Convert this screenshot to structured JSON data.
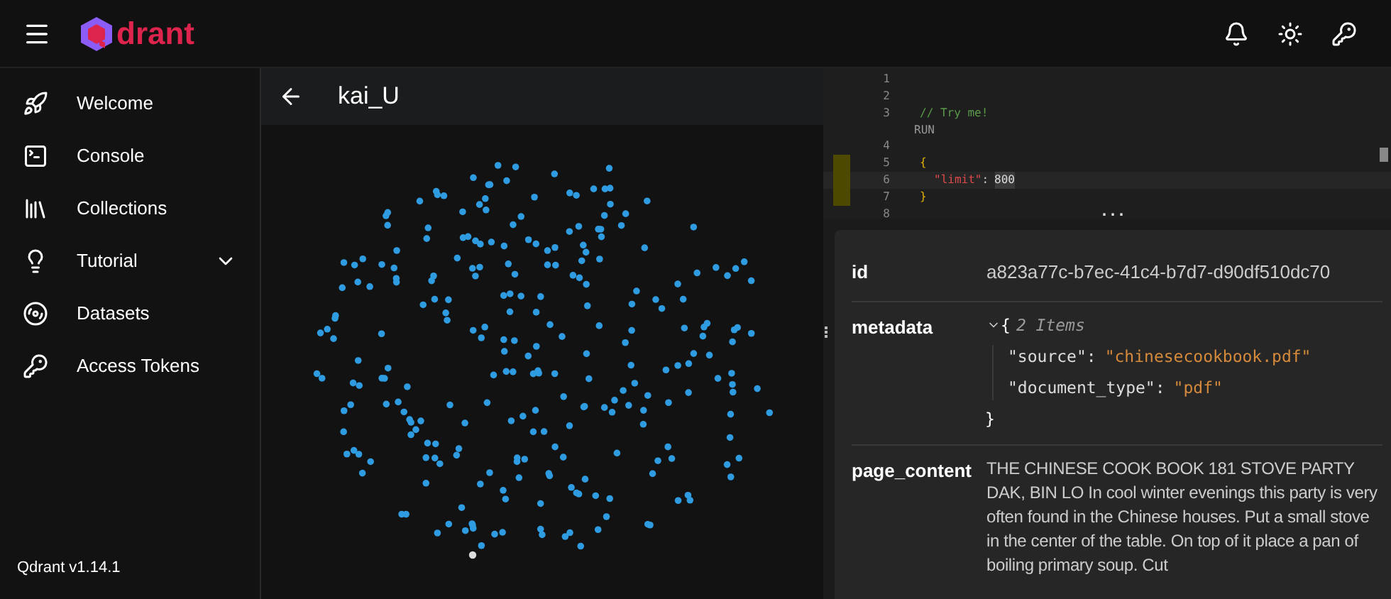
{
  "header": {
    "logo_text": "drant"
  },
  "sidebar": {
    "items": [
      {
        "label": "Welcome",
        "expandable": false
      },
      {
        "label": "Console",
        "expandable": false
      },
      {
        "label": "Collections",
        "expandable": false
      },
      {
        "label": "Tutorial",
        "expandable": true
      },
      {
        "label": "Datasets",
        "expandable": false
      },
      {
        "label": "Access Tokens",
        "expandable": false
      }
    ],
    "version": "Qdrant v1.14.1"
  },
  "collection": {
    "title": "kai_U"
  },
  "editor": {
    "lines": [
      {
        "number": "1",
        "kind": "blank",
        "marked": false
      },
      {
        "number": "2",
        "kind": "blank",
        "marked": false
      },
      {
        "number": "3",
        "kind": "comment",
        "text": "// Try me!",
        "marked": false
      },
      {
        "number": "4",
        "kind": "blank",
        "lens": "RUN",
        "marked": false
      },
      {
        "number": "5",
        "kind": "brace",
        "text": "{",
        "marked": true
      },
      {
        "number": "6",
        "kind": "pair",
        "key": "\"limit\"",
        "colon": ":",
        "value": "800",
        "marked": true
      },
      {
        "number": "7",
        "kind": "brace",
        "text": "}",
        "marked": true
      },
      {
        "number": "8",
        "kind": "blank",
        "marked": false
      }
    ],
    "splitter": "..."
  },
  "details": {
    "id_label": "id",
    "id_value": "a823a77c-b7ec-41c4-b7d7-d90df510dc70",
    "metadata_label": "metadata",
    "open_brace": "{",
    "metadata_count": "2 Items",
    "metadata": [
      {
        "key": "\"source\"",
        "colon": ":",
        "value": "\"chinesecookbook.pdf\""
      },
      {
        "key": "\"document_type\"",
        "colon": ":",
        "value": "\"pdf\""
      }
    ],
    "close_brace": "}",
    "content_label": "page_content",
    "content": "THE CHINESE COOK BOOK 181 STOVE PARTY DAK, BIN LO In cool winter evenings this party is very often found in the Chinese houses. Put a small stove in the center of the table. On top of it place a pan of boiling primary soup. Cut"
  }
}
